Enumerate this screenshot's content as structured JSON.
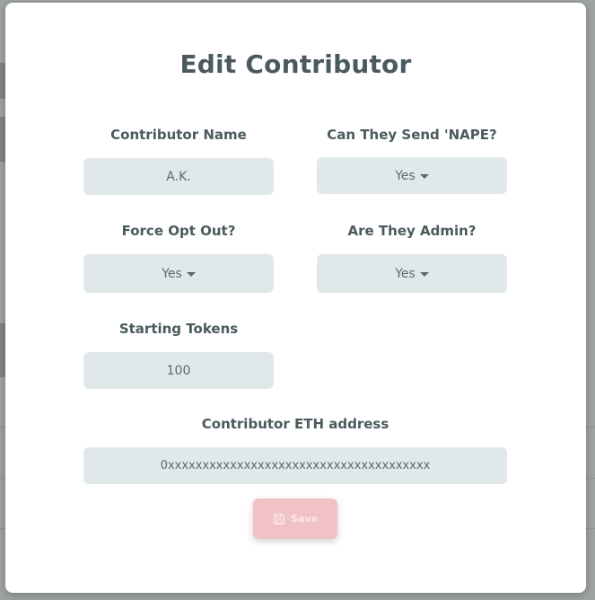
{
  "modal": {
    "title": "Edit Contributor",
    "fields": {
      "contributor_name": {
        "label": "Contributor Name",
        "value": "A.K."
      },
      "can_send": {
        "label": "Can They Send 'NAPE?",
        "value": "Yes"
      },
      "force_opt_out": {
        "label": "Force Opt Out?",
        "value": "Yes"
      },
      "is_admin": {
        "label": "Are They Admin?",
        "value": "Yes"
      },
      "starting_tokens": {
        "label": "Starting Tokens",
        "value": "100"
      },
      "eth_address": {
        "label": "Contributor ETH address",
        "value": "0xxxxxxxxxxxxxxxxxxxxxxxxxxxxxxxxxxxxxx"
      }
    },
    "save_label": "Save",
    "save_icon": "floppy-disk-icon"
  },
  "colors": {
    "title": "#4a5a5e",
    "field_bg": "#e1e8ea",
    "save_bg": "#f0c2c6",
    "overlay": "#9ea3a3"
  }
}
